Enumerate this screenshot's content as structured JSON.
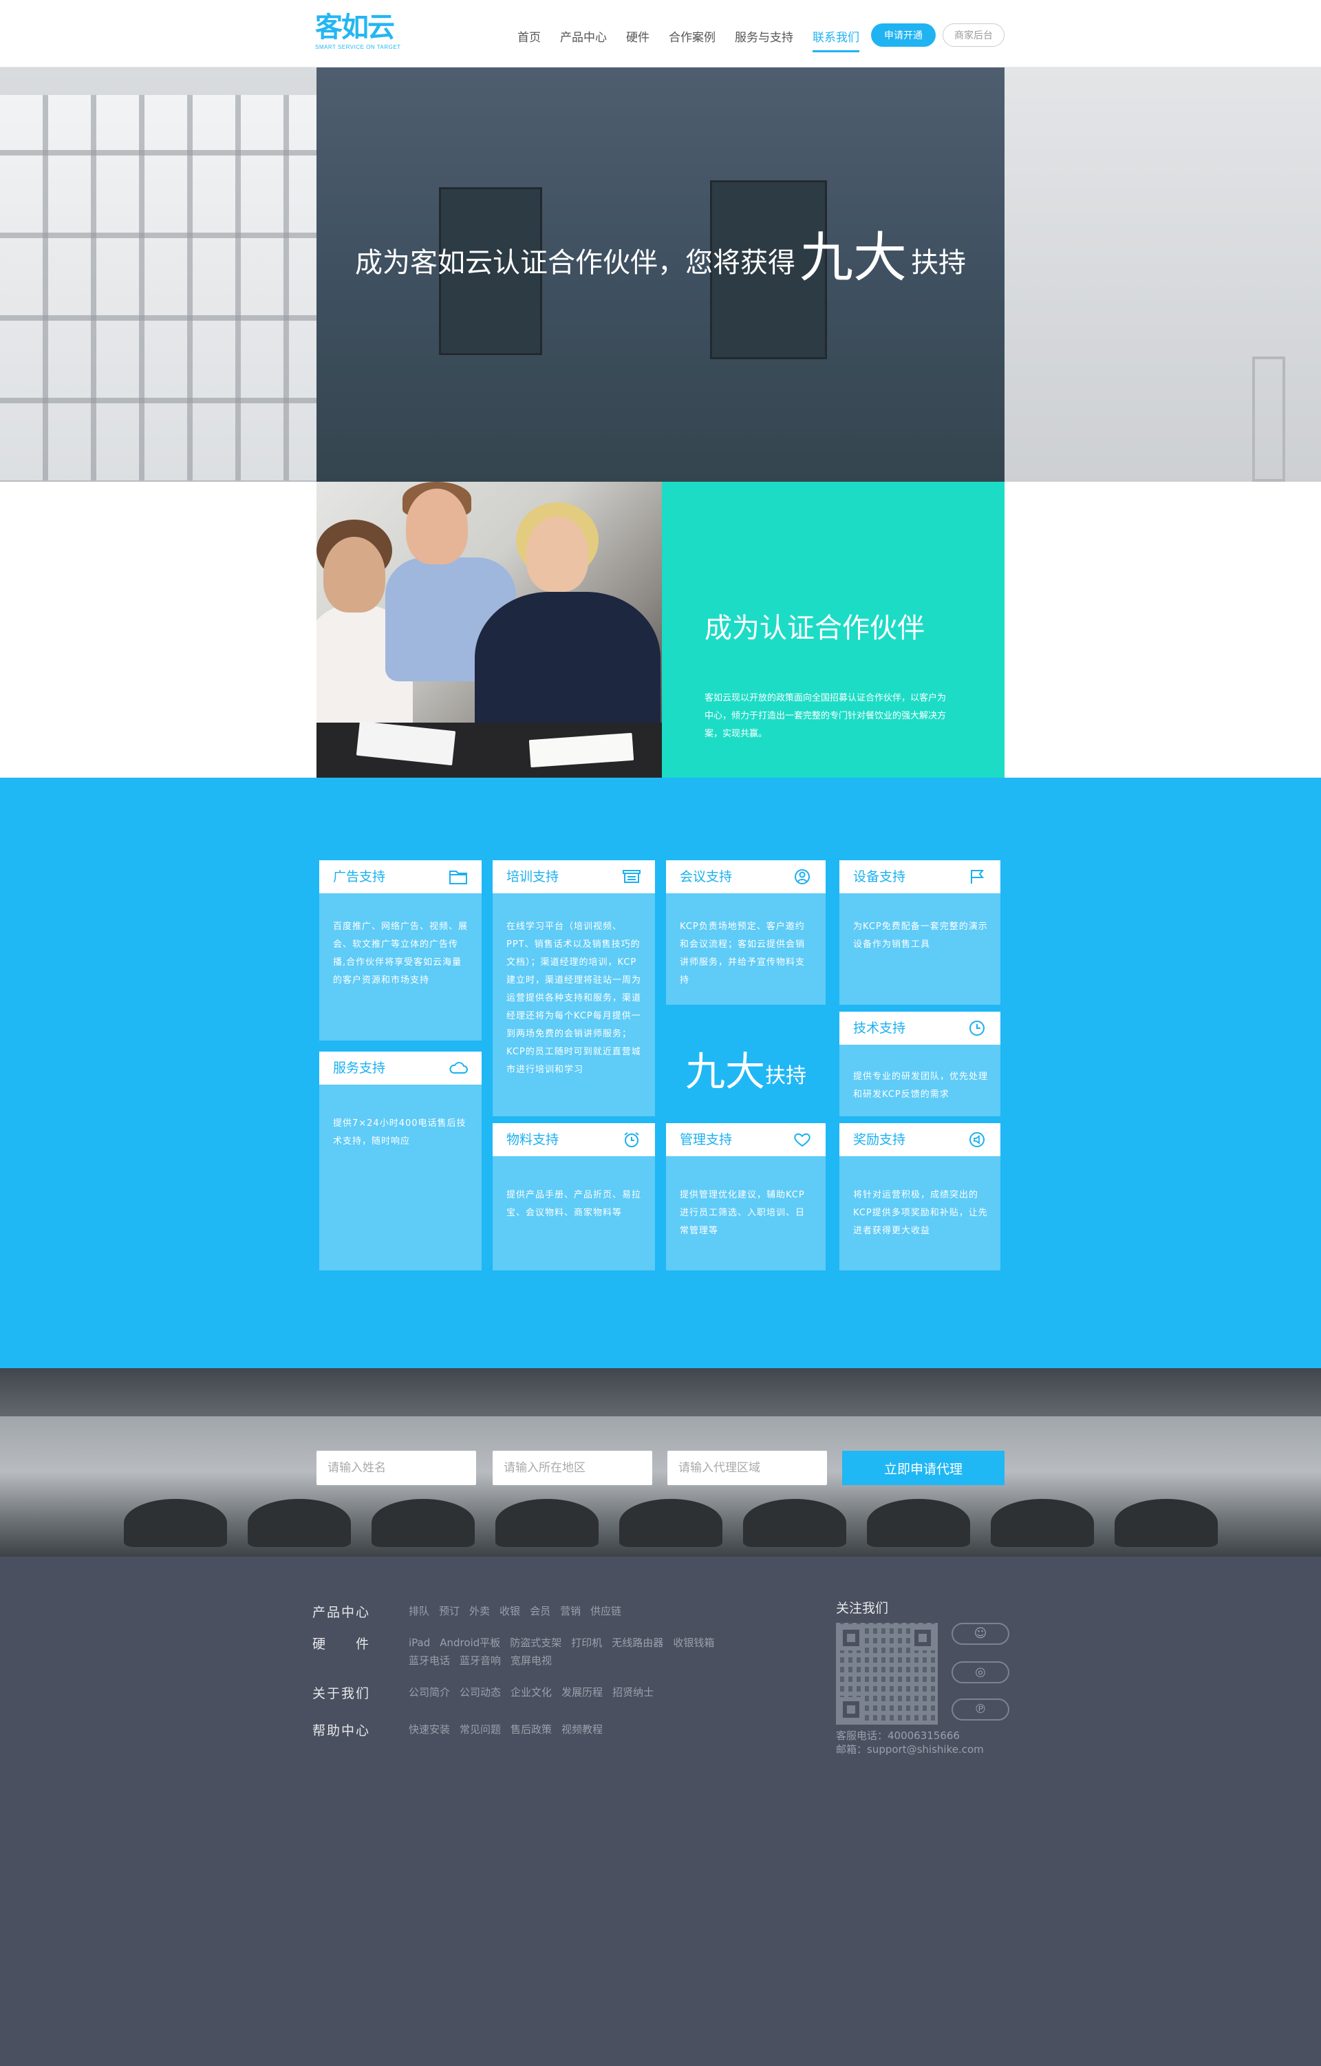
{
  "brand": {
    "logo": "客如云",
    "tagline": "SMART SERVICE ON TARGET"
  },
  "nav": {
    "items": [
      "首页",
      "产品中心",
      "硬件",
      "合作案例",
      "服务与支持",
      "联系我们"
    ],
    "active_index": 5,
    "apply_label": "申请开通",
    "merchant_label": "商家后台"
  },
  "hero": {
    "title_pre": "成为客如云认证合作伙伴，您将获得",
    "title_big": "九大",
    "title_post": "扶持"
  },
  "partner": {
    "title": "成为认证合作伙伴",
    "desc": "客如云现以开放的政策面向全国招募认证合作伙伴，以客户为中心，倾力于打造出一套完整的专门针对餐饮业的强大解决方案，实现共赢。"
  },
  "support": {
    "center_big": "九大",
    "center_small": "扶持",
    "cards": [
      {
        "title": "广告支持",
        "icon": "folder-icon",
        "body": "百度推广、网络广告、视频、展会、软文推广等立体的广告传播,合作伙伴将享受客如云海量的客户资源和市场支持"
      },
      {
        "title": "培训支持",
        "icon": "training-board-icon",
        "body": "在线学习平台（培训视频、PPT、销售话术以及销售技巧的文档）；渠道经理的培训，KCP建立时，渠道经理将驻站一周为运营提供各种支持和服务，渠道经理还将为每个KCP每月提供一到两场免费的会销讲师服务；KCP的员工随时可到就近直营城市进行培训和学习"
      },
      {
        "title": "会议支持",
        "icon": "user-circle-icon",
        "body": "KCP负责场地预定、客户邀约和会议流程；客如云提供会销讲师服务，并给予宣传物料支持"
      },
      {
        "title": "设备支持",
        "icon": "flag-icon",
        "body": "为KCP免费配备一套完整的演示设备作为销售工具"
      },
      {
        "title": "服务支持",
        "icon": "cloud-icon",
        "body": "提供7×24小时400电话售后技术支持，随时响应"
      },
      {
        "title": "技术支持",
        "icon": "clock-icon",
        "body": "提供专业的研发团队，优先处理和研发KCP反馈的需求"
      },
      {
        "title": "物料支持",
        "icon": "alarm-clock-icon",
        "body": "提供产品手册、产品折页、易拉宝、会议物料、商家物料等"
      },
      {
        "title": "管理支持",
        "icon": "heart-icon",
        "body": "提供管理优化建议，辅助KCP进行员工筛选、入职培训、日常管理等"
      },
      {
        "title": "奖励支持",
        "icon": "speaker-icon",
        "body": "将针对运营积极，成绩突出的KCP提供多项奖励和补贴，让先进者获得更大收益"
      }
    ]
  },
  "apply": {
    "name_placeholder": "请输入姓名",
    "region_placeholder": "请输入所在地区",
    "agent_placeholder": "请输入代理区域",
    "submit_label": "立即申请代理"
  },
  "footer": {
    "rows": [
      {
        "label": "产品中心",
        "links": [
          "排队",
          "预订",
          "外卖",
          "收银",
          "会员",
          "营销",
          "供应链"
        ]
      },
      {
        "label": "硬　　件",
        "links": [
          "iPad",
          "Android平板",
          "防盗式支架",
          "打印机",
          "无线路由器",
          "收银钱箱",
          "蓝牙电话",
          "蓝牙音响",
          "宽屏电视"
        ]
      },
      {
        "label": "关于我们",
        "links": [
          "公司简介",
          "公司动态",
          "企业文化",
          "发展历程",
          "招贤纳士"
        ]
      },
      {
        "label": "帮助中心",
        "links": [
          "快速安装",
          "常见问题",
          "售后政策",
          "视频教程"
        ]
      }
    ],
    "follow_title": "关注我们",
    "phone": "客服电话：40006315666",
    "email": "邮箱：support@shishike.com"
  }
}
